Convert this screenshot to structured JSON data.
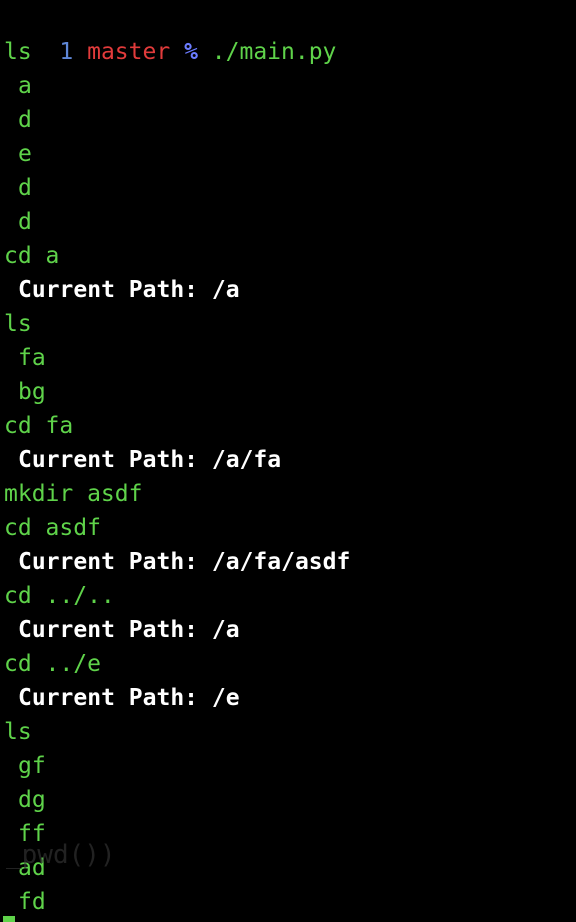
{
  "prompt": {
    "line_number": "1",
    "branch": "master",
    "symbol": "%",
    "command": "./main.py"
  },
  "output": [
    {
      "text": "ls",
      "kind": "cmd"
    },
    {
      "text": "a",
      "kind": "item"
    },
    {
      "text": "d",
      "kind": "item"
    },
    {
      "text": "e",
      "kind": "item"
    },
    {
      "text": "d",
      "kind": "item"
    },
    {
      "text": "d",
      "kind": "item"
    },
    {
      "text": "cd a",
      "kind": "cmd"
    },
    {
      "text": "Current Path: /a",
      "kind": "path"
    },
    {
      "text": "ls",
      "kind": "cmd"
    },
    {
      "text": "fa",
      "kind": "item"
    },
    {
      "text": "bg",
      "kind": "item"
    },
    {
      "text": "cd fa",
      "kind": "cmd"
    },
    {
      "text": "Current Path: /a/fa",
      "kind": "path"
    },
    {
      "text": "mkdir asdf",
      "kind": "cmd"
    },
    {
      "text": "cd asdf",
      "kind": "cmd"
    },
    {
      "text": "Current Path: /a/fa/asdf",
      "kind": "path"
    },
    {
      "text": "cd ../..",
      "kind": "cmd"
    },
    {
      "text": "Current Path: /a",
      "kind": "path"
    },
    {
      "text": "cd ../e",
      "kind": "cmd"
    },
    {
      "text": "Current Path: /e",
      "kind": "path"
    },
    {
      "text": "ls",
      "kind": "cmd"
    },
    {
      "text": "gf",
      "kind": "item"
    },
    {
      "text": "dg",
      "kind": "item"
    },
    {
      "text": "ff",
      "kind": "item"
    },
    {
      "text": "ad",
      "kind": "item"
    },
    {
      "text": "fd",
      "kind": "item"
    }
  ],
  "ghost_text": "_pwd())",
  "colors": {
    "background": "#000000",
    "line_number": "#5f87d7",
    "branch": "#e23b3b",
    "prompt_symbol": "#6b7cff",
    "command": "#5fd34a",
    "path": "#ffffff"
  }
}
